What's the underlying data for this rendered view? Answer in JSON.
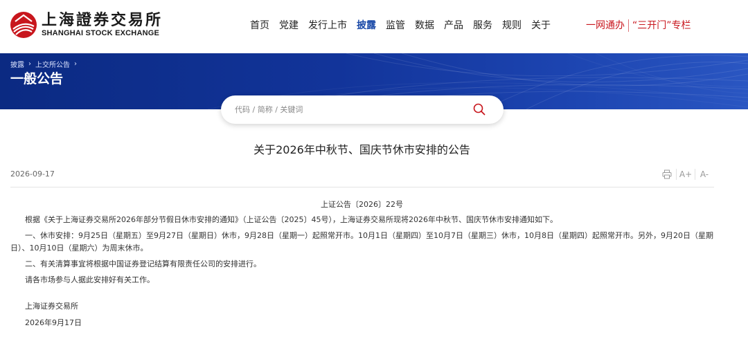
{
  "logo": {
    "cn": "上海證券交易所",
    "en": "SHANGHAI STOCK EXCHANGE"
  },
  "nav": [
    "首页",
    "党建",
    "发行上市",
    "披露",
    "监管",
    "数据",
    "产品",
    "服务",
    "规则",
    "关于"
  ],
  "nav_active": "披露",
  "special": {
    "link1": "一网通办",
    "link2": "“三开门”专栏"
  },
  "breadcrumb": [
    "披露",
    "上交所公告"
  ],
  "banner_title": "一般公告",
  "search": {
    "placeholder": "代码 / 简称 / 关键词"
  },
  "article": {
    "title": "关于2026年中秋节、国庆节休市安排的公告",
    "date": "2026-09-17",
    "doc_number": "上证公告〔2026〕22号",
    "paragraphs": [
      "根据《关于上海证券交易所2026年部分节假日休市安排的通知》（上证公告〔2025〕45号），上海证券交易所现将2026年中秋节、国庆节休市安排通知如下。",
      "一、休市安排：9月25日（星期五）至9月27日（星期日）休市，9月28日（星期一）起照常开市。10月1日（星期四）至10月7日（星期三）休市，10月8日（星期四）起照常开市。另外，9月20日（星期日）、10月10日（星期六）为周末休市。",
      "二、有关清算事宜将根据中国证券登记结算有限责任公司的安排进行。",
      "请各市场参与人据此安排好有关工作。"
    ],
    "signature": "上海证券交易所",
    "sign_date": "2026年9月17日"
  },
  "tools": {
    "font_up": "A+",
    "font_down": "A-",
    "print_icon": "printer-icon"
  },
  "colors": {
    "brand_red": "#c8161d",
    "nav_active": "#1b4aa8",
    "banner": "#12349a"
  }
}
